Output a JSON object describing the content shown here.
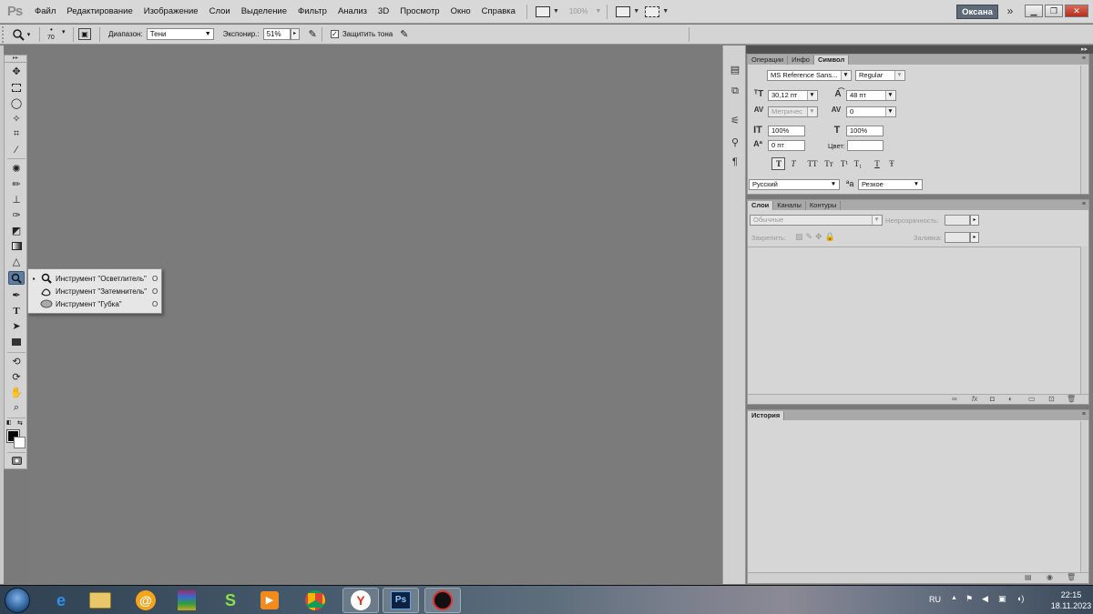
{
  "app": {
    "logo": "Ps"
  },
  "menu": [
    "Файл",
    "Редактирование",
    "Изображение",
    "Слои",
    "Выделение",
    "Фильтр",
    "Анализ",
    "3D",
    "Просмотр",
    "Окно",
    "Справка"
  ],
  "menubar": {
    "zoom": "100%",
    "user": "Оксана"
  },
  "options_bar": {
    "brush_size": "70",
    "range_label": "Диапазон:",
    "range_value": "Тени",
    "exposure_label": "Экспонир.:",
    "exposure_value": "51%",
    "protect_tones_label": "Защитить тона",
    "protect_tones_checked": true
  },
  "flyout": {
    "items": [
      {
        "label": "Инструмент \"Осветлитель\"",
        "key": "O",
        "selected": true,
        "icon": "dodge-icon"
      },
      {
        "label": "Инструмент \"Затемнитель\"",
        "key": "O",
        "selected": false,
        "icon": "burn-icon"
      },
      {
        "label": "Инструмент \"Губка\"",
        "key": "O",
        "selected": false,
        "icon": "sponge-icon"
      }
    ]
  },
  "character_panel": {
    "tabs": [
      "Операции",
      "Инфо",
      "Символ"
    ],
    "active_tab": "Символ",
    "font_family": "MS Reference Sans...",
    "font_style": "Regular",
    "font_size": "30,12 пт",
    "leading": "48 пт",
    "kerning": "Метричес",
    "tracking": "0",
    "vertical_scale": "100%",
    "horizontal_scale": "100%",
    "baseline_shift": "0 пт",
    "color_label": "Цвет:",
    "color": "#ffffff",
    "type_buttons": [
      "T",
      "T",
      "TT",
      "Tт",
      "T¹",
      "T₁",
      "T",
      "Ŧ"
    ],
    "language": "Русский",
    "antialias_label": "a",
    "antialias": "Резкое"
  },
  "layers_panel": {
    "tabs": [
      "Слои",
      "Каналы",
      "Контуры"
    ],
    "active_tab": "Слои",
    "blend_mode": "Обычные",
    "opacity_label": "Непрозрачность:",
    "lock_label": "Закрепить:",
    "fill_label": "Заливка:"
  },
  "history_panel": {
    "tabs": [
      "История"
    ],
    "active_tab": "История"
  },
  "taskbar": {
    "language": "RU",
    "time": "22:15",
    "date": "18.11.2023"
  }
}
